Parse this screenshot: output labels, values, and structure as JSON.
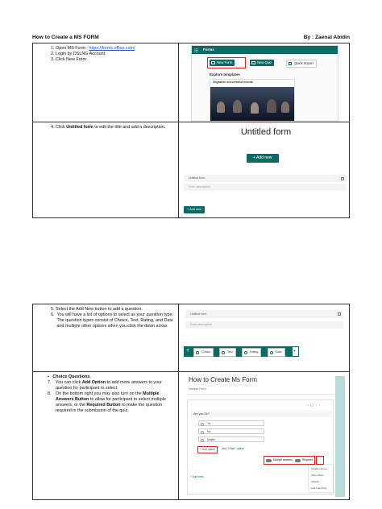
{
  "header": {
    "title": "How to Create a MS FORM",
    "author": "By : Zaenal Abidin"
  },
  "table1": {
    "row1": {
      "steps": [
        {
          "num": "1.",
          "text": "Open MS Form : ",
          "link": "https://forms.office.com/"
        },
        {
          "num": "2.",
          "text": "Login by DSLNG Account"
        },
        {
          "num": "3.",
          "text": "Click New Form"
        }
      ],
      "shot": {
        "app_name": "Forms",
        "new_form": "New Form",
        "new_quiz": "New Quiz",
        "quick_import": "Quick Import",
        "explore": "Explore templates",
        "template": "Organize successful events"
      }
    },
    "row2": {
      "step_num": "4.",
      "step_pre": "Click ",
      "step_bold": "Untitled form",
      "step_post": " to edit the title and add a description.",
      "shot": {
        "form_title": "Untitled form",
        "add_new": "Add new",
        "title_field": "Untitled form",
        "desc_field": "Form description",
        "add_new_small": "Add new"
      }
    }
  },
  "table2": {
    "row1": {
      "steps": [
        {
          "num": "5.",
          "text": "Select the Add New button to add a question."
        },
        {
          "num": "6.",
          "text": "You will have a list of options to select as your question type. The question types consist of Choice, Text, Rating, and Date and multiple other options when you click the down arrow."
        }
      ],
      "shot": {
        "title_field": "Untitled form",
        "desc_field": "Form description",
        "types": [
          "Choice",
          "Text",
          "Rating",
          "Date"
        ]
      }
    },
    "row2": {
      "bullet_label": "Choice Questions.",
      "step7_num": "7.",
      "step7_pre": "You can click ",
      "step7_bold": "Add Option",
      "step7_post": " to add more answers to your question for participant to select.",
      "step8_num": "8.",
      "step8_pre": "On the bottom right you may also turn on the ",
      "step8_bold1": "Multiple Answers Button",
      "step8_mid": " to allow for participant to select multiple answers, or the ",
      "step8_bold2": "Required Button",
      "step8_post": " to make the question required in the submission of the quiz.",
      "shot": {
        "form_title": "How to Create Ms Form",
        "form_sub": "Sample Form",
        "question": "Are you Ok?",
        "options": [
          "Ya",
          "No",
          "Maybe"
        ],
        "add_option": "+ Add option",
        "add_other": "Add \"Other\" option",
        "multiple": "Multiple answers",
        "required": "Required",
        "menu": [
          "Shuffle options",
          "Show Sliver",
          "Subtitle",
          "Add branching"
        ],
        "add_new": "+ Add new"
      }
    }
  }
}
